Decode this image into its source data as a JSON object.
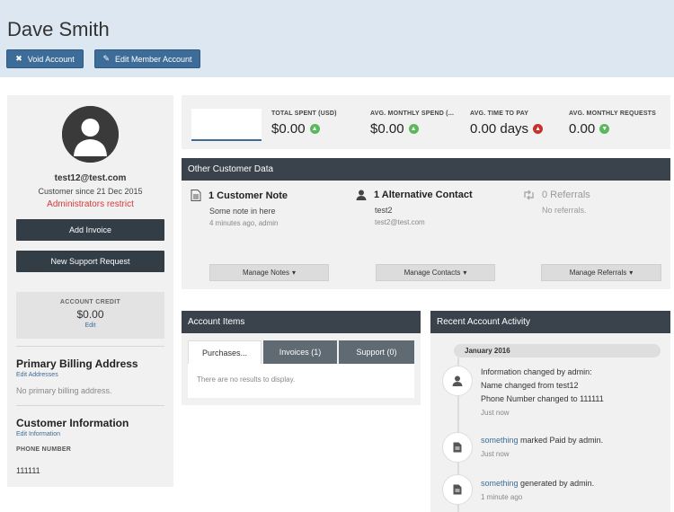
{
  "header": {
    "title": "Dave Smith",
    "void_label": "Void Account",
    "edit_label": "Edit Member Account"
  },
  "profile": {
    "email": "test12@test.com",
    "since": "Customer since 21 Dec 2015",
    "restriction": "Administrators restrict",
    "add_invoice": "Add Invoice",
    "new_support": "New Support Request"
  },
  "credit": {
    "label": "ACCOUNT CREDIT",
    "amount": "$0.00",
    "edit": "Edit"
  },
  "billing": {
    "title": "Primary Billing Address",
    "edit": "Edit Addresses",
    "empty": "No primary billing address."
  },
  "info": {
    "title": "Customer Information",
    "edit": "Edit Information",
    "phone_label": "PHONE NUMBER",
    "phone": "111111"
  },
  "stats": [
    {
      "label": "TOTAL SPENT (USD)",
      "value": "$0.00",
      "trend": "up"
    },
    {
      "label": "AVG. MONTHLY SPEND (...",
      "value": "$0.00",
      "trend": "up"
    },
    {
      "label": "AVG. TIME TO PAY",
      "value": "0.00 days",
      "trend": "up-bad"
    },
    {
      "label": "AVG. MONTHLY REQUESTS",
      "value": "0.00",
      "trend": "down"
    }
  ],
  "other": {
    "title": "Other Customer Data",
    "notes": {
      "title": "1 Customer Note",
      "line1": "Some note in here",
      "line2": "4 minutes ago, admin",
      "button": "Manage Notes"
    },
    "contacts": {
      "title": "1 Alternative Contact",
      "line1": "test2",
      "line2": "test2@test.com",
      "button": "Manage Contacts"
    },
    "referrals": {
      "title": "0 Referrals",
      "line1": "No referrals.",
      "button": "Manage Referrals"
    }
  },
  "items": {
    "title": "Account Items",
    "tabs": [
      "Purchases...",
      "Invoices (1)",
      "Support (0)"
    ],
    "empty": "There are no results to display."
  },
  "activity": {
    "title": "Recent Account Activity",
    "month": "January 2016",
    "e1": {
      "l1": "Information changed by admin:",
      "l2": "Name changed from test12",
      "l3": "Phone Number changed to 111111",
      "time": "Just now"
    },
    "e2": {
      "link": "something",
      "rest": " marked Paid by admin.",
      "time": "Just now"
    },
    "e3": {
      "link": "something",
      "rest": " generated by admin.",
      "time": "1 minute ago"
    }
  }
}
